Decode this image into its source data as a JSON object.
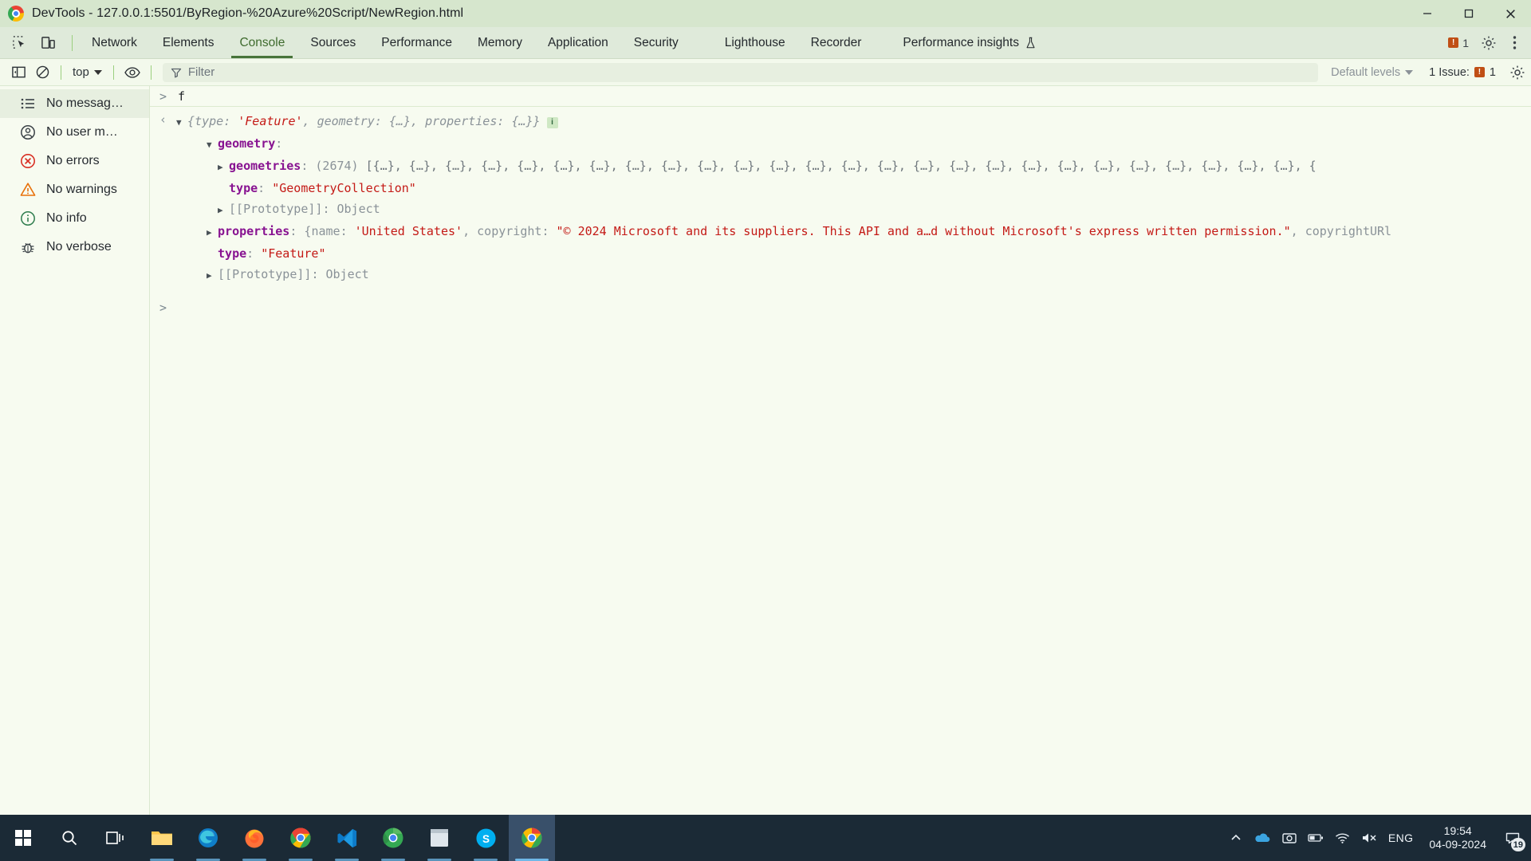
{
  "window": {
    "title": "DevTools - 127.0.0.1:5501/ByRegion-%20Azure%20Script/NewRegion.html",
    "minimize_label": "Minimize",
    "maximize_label": "Maximize",
    "close_label": "Close"
  },
  "tabbar": {
    "inspect_icon": "inspect-element-icon",
    "device_icon": "device-toolbar-icon",
    "tabs": [
      {
        "label": "Network",
        "active": false
      },
      {
        "label": "Elements",
        "active": false
      },
      {
        "label": "Console",
        "active": true
      },
      {
        "label": "Sources",
        "active": false
      },
      {
        "label": "Performance",
        "active": false
      },
      {
        "label": "Memory",
        "active": false
      },
      {
        "label": "Application",
        "active": false
      },
      {
        "label": "Security",
        "active": false
      },
      {
        "label": "Lighthouse",
        "active": false
      },
      {
        "label": "Recorder",
        "active": false
      },
      {
        "label": "Performance insights",
        "active": false,
        "icon": "flask-icon"
      }
    ],
    "issues_count": "1",
    "settings_icon": "gear-icon",
    "more_icon": "kebab-menu-icon"
  },
  "console_toolbar": {
    "sidebar_toggle_icon": "show-console-sidebar-icon",
    "clear_icon": "clear-console-icon",
    "context_label": "top",
    "live_expression_icon": "eye-icon",
    "filter_icon": "filter-icon",
    "filter_placeholder": "Filter",
    "filter_value": "",
    "levels_label": "Default levels",
    "issues_text": "1 Issue:",
    "issues_count": "1",
    "settings_icon": "console-settings-icon"
  },
  "sidebar": {
    "items": [
      {
        "label": "No messag…",
        "icon": "list-icon",
        "selected": true
      },
      {
        "label": "No user m…",
        "icon": "user-icon",
        "selected": false
      },
      {
        "label": "No errors",
        "icon": "error-circle-icon",
        "selected": false
      },
      {
        "label": "No warnings",
        "icon": "warning-triangle-icon",
        "selected": false
      },
      {
        "label": "No info",
        "icon": "info-circle-icon",
        "selected": false
      },
      {
        "label": "No verbose",
        "icon": "verbose-bug-icon",
        "selected": false
      }
    ]
  },
  "console": {
    "input_prompt": ">",
    "input_command": "f",
    "return_arrow": "‹",
    "result_preview": {
      "open_brace": "{",
      "k1": "type",
      "v1": "'Feature'",
      "sep1": ", ",
      "k2": "geometry",
      "v2": "{…}",
      "sep2": ", ",
      "k3": "properties",
      "v3": "{…}",
      "close_brace": "}",
      "badge": "i"
    },
    "rows": [
      {
        "key": "geometry",
        "value": ""
      },
      {
        "key": "geometries",
        "count": "(2674)",
        "value": "[{…}, {…}, {…}, {…}, {…}, {…}, {…}, {…}, {…}, {…}, {…}, {…}, {…}, {…}, {…}, {…}, {…}, {…}, {…}, {…}, {…}, {…}, {…}, {…}, {…}, {…}, {"
      },
      {
        "key": "type",
        "value": "\"GeometryCollection\""
      },
      {
        "key": "[[Prototype]]",
        "value": "Object"
      },
      {
        "key": "properties",
        "value": ""
      },
      {
        "key": "type",
        "value": "\"Feature\""
      },
      {
        "key": "[[Prototype]]",
        "value": "Object"
      }
    ],
    "properties_inline": {
      "open": "{",
      "k_name": "name",
      "v_name": "'United States'",
      "sep": ", ",
      "k_copyright": "copyright",
      "v_copyright": "\"© 2024 Microsoft and its suppliers. This API and a…d without Microsoft's express written permission.\"",
      "tail": ", copyrightURl"
    },
    "trailing_prompt": ">"
  },
  "taskbar": {
    "start_icon": "windows-start-icon",
    "search_icon": "search-icon",
    "taskview_icon": "task-view-icon",
    "apps": [
      {
        "name": "file-explorer-icon"
      },
      {
        "name": "microsoft-edge-icon"
      },
      {
        "name": "firefox-icon"
      },
      {
        "name": "google-chrome-icon"
      },
      {
        "name": "vs-code-icon"
      },
      {
        "name": "chrome-canary-icon"
      },
      {
        "name": "sticky-notes-icon"
      },
      {
        "name": "skype-icon"
      },
      {
        "name": "chrome-devtools-icon"
      }
    ],
    "tray": {
      "chevron_icon": "show-hidden-icons-icon",
      "onedrive_icon": "onedrive-icon",
      "screenshot_icon": "snip-icon",
      "battery_icon": "battery-icon",
      "wifi_icon": "wifi-icon",
      "volume_icon": "volume-muted-icon",
      "language": "ENG",
      "time": "19:54",
      "date": "04-09-2024",
      "notification_count": "19"
    }
  },
  "colors": {
    "titlebar_bg": "#d6e6cd",
    "tabbar_bg": "#dfeada",
    "active_tab": "#47743a",
    "string_red": "#c41a16",
    "property_purple": "#881391",
    "taskbar_bg": "#1b2a36"
  }
}
